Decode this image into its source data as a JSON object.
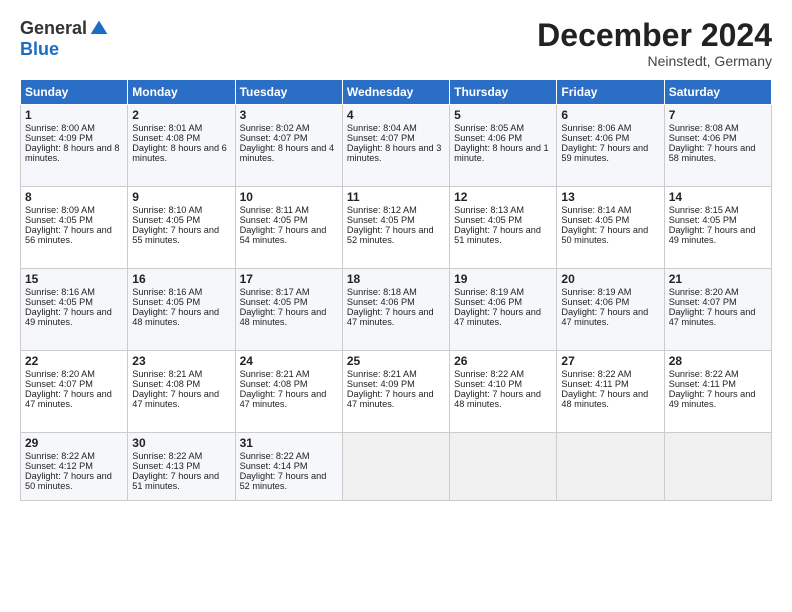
{
  "header": {
    "logo_general": "General",
    "logo_blue": "Blue",
    "month_title": "December 2024",
    "subtitle": "Neinstedt, Germany"
  },
  "days_of_week": [
    "Sunday",
    "Monday",
    "Tuesday",
    "Wednesday",
    "Thursday",
    "Friday",
    "Saturday"
  ],
  "weeks": [
    [
      {
        "day": "1",
        "sunrise": "8:00 AM",
        "sunset": "4:09 PM",
        "daylight": "8 hours and 8 minutes."
      },
      {
        "day": "2",
        "sunrise": "8:01 AM",
        "sunset": "4:08 PM",
        "daylight": "8 hours and 6 minutes."
      },
      {
        "day": "3",
        "sunrise": "8:02 AM",
        "sunset": "4:07 PM",
        "daylight": "8 hours and 4 minutes."
      },
      {
        "day": "4",
        "sunrise": "8:04 AM",
        "sunset": "4:07 PM",
        "daylight": "8 hours and 3 minutes."
      },
      {
        "day": "5",
        "sunrise": "8:05 AM",
        "sunset": "4:06 PM",
        "daylight": "8 hours and 1 minute."
      },
      {
        "day": "6",
        "sunrise": "8:06 AM",
        "sunset": "4:06 PM",
        "daylight": "7 hours and 59 minutes."
      },
      {
        "day": "7",
        "sunrise": "8:08 AM",
        "sunset": "4:06 PM",
        "daylight": "7 hours and 58 minutes."
      }
    ],
    [
      {
        "day": "8",
        "sunrise": "8:09 AM",
        "sunset": "4:05 PM",
        "daylight": "7 hours and 56 minutes."
      },
      {
        "day": "9",
        "sunrise": "8:10 AM",
        "sunset": "4:05 PM",
        "daylight": "7 hours and 55 minutes."
      },
      {
        "day": "10",
        "sunrise": "8:11 AM",
        "sunset": "4:05 PM",
        "daylight": "7 hours and 54 minutes."
      },
      {
        "day": "11",
        "sunrise": "8:12 AM",
        "sunset": "4:05 PM",
        "daylight": "7 hours and 52 minutes."
      },
      {
        "day": "12",
        "sunrise": "8:13 AM",
        "sunset": "4:05 PM",
        "daylight": "7 hours and 51 minutes."
      },
      {
        "day": "13",
        "sunrise": "8:14 AM",
        "sunset": "4:05 PM",
        "daylight": "7 hours and 50 minutes."
      },
      {
        "day": "14",
        "sunrise": "8:15 AM",
        "sunset": "4:05 PM",
        "daylight": "7 hours and 49 minutes."
      }
    ],
    [
      {
        "day": "15",
        "sunrise": "8:16 AM",
        "sunset": "4:05 PM",
        "daylight": "7 hours and 49 minutes."
      },
      {
        "day": "16",
        "sunrise": "8:16 AM",
        "sunset": "4:05 PM",
        "daylight": "7 hours and 48 minutes."
      },
      {
        "day": "17",
        "sunrise": "8:17 AM",
        "sunset": "4:05 PM",
        "daylight": "7 hours and 48 minutes."
      },
      {
        "day": "18",
        "sunrise": "8:18 AM",
        "sunset": "4:06 PM",
        "daylight": "7 hours and 47 minutes."
      },
      {
        "day": "19",
        "sunrise": "8:19 AM",
        "sunset": "4:06 PM",
        "daylight": "7 hours and 47 minutes."
      },
      {
        "day": "20",
        "sunrise": "8:19 AM",
        "sunset": "4:06 PM",
        "daylight": "7 hours and 47 minutes."
      },
      {
        "day": "21",
        "sunrise": "8:20 AM",
        "sunset": "4:07 PM",
        "daylight": "7 hours and 47 minutes."
      }
    ],
    [
      {
        "day": "22",
        "sunrise": "8:20 AM",
        "sunset": "4:07 PM",
        "daylight": "7 hours and 47 minutes."
      },
      {
        "day": "23",
        "sunrise": "8:21 AM",
        "sunset": "4:08 PM",
        "daylight": "7 hours and 47 minutes."
      },
      {
        "day": "24",
        "sunrise": "8:21 AM",
        "sunset": "4:08 PM",
        "daylight": "7 hours and 47 minutes."
      },
      {
        "day": "25",
        "sunrise": "8:21 AM",
        "sunset": "4:09 PM",
        "daylight": "7 hours and 47 minutes."
      },
      {
        "day": "26",
        "sunrise": "8:22 AM",
        "sunset": "4:10 PM",
        "daylight": "7 hours and 48 minutes."
      },
      {
        "day": "27",
        "sunrise": "8:22 AM",
        "sunset": "4:11 PM",
        "daylight": "7 hours and 48 minutes."
      },
      {
        "day": "28",
        "sunrise": "8:22 AM",
        "sunset": "4:11 PM",
        "daylight": "7 hours and 49 minutes."
      }
    ],
    [
      {
        "day": "29",
        "sunrise": "8:22 AM",
        "sunset": "4:12 PM",
        "daylight": "7 hours and 50 minutes."
      },
      {
        "day": "30",
        "sunrise": "8:22 AM",
        "sunset": "4:13 PM",
        "daylight": "7 hours and 51 minutes."
      },
      {
        "day": "31",
        "sunrise": "8:22 AM",
        "sunset": "4:14 PM",
        "daylight": "7 hours and 52 minutes."
      },
      null,
      null,
      null,
      null
    ]
  ]
}
